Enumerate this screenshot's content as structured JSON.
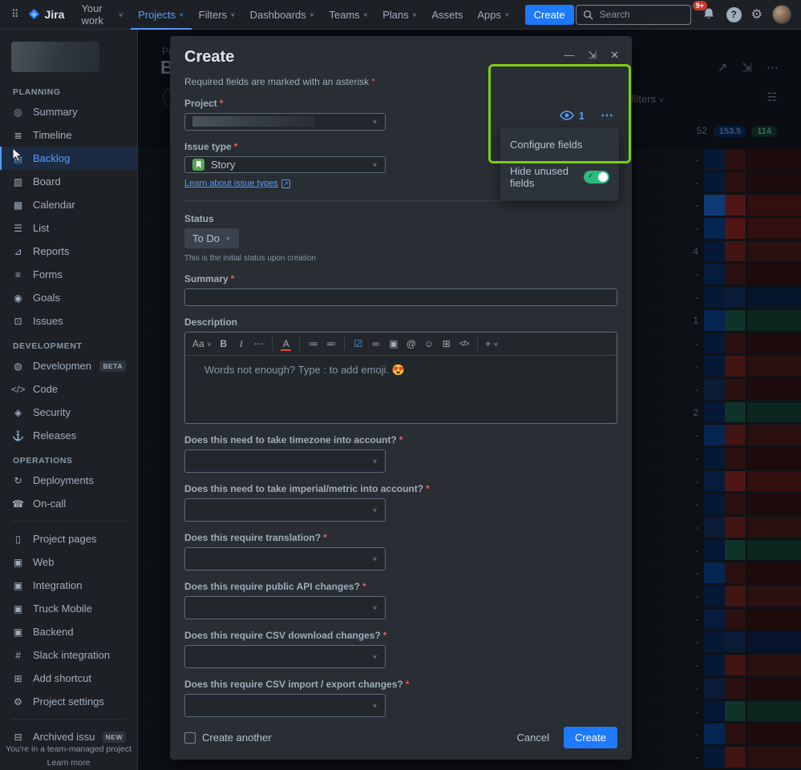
{
  "colors": {
    "accent_blue": "#579dff",
    "button_blue": "#1d7afc",
    "annotation_green": "#7ccd12",
    "toggle_green": "#2abb7f",
    "story_green": "#57a55a",
    "required_red": "#f15b50",
    "notification_red": "#c9372c"
  },
  "topnav": {
    "app_name": "Jira",
    "items": [
      {
        "label": "Your work"
      },
      {
        "label": "Projects",
        "active": true
      },
      {
        "label": "Filters"
      },
      {
        "label": "Dashboards"
      },
      {
        "label": "Teams"
      },
      {
        "label": "Plans"
      },
      {
        "label": "Assets",
        "chevron": false
      },
      {
        "label": "Apps"
      }
    ],
    "create_button": "Create",
    "search_placeholder": "Search",
    "notification_badge": "9+"
  },
  "sidebar": {
    "sections": [
      {
        "title": "PLANNING",
        "items": [
          {
            "label": "Summary",
            "icon": "summary-icon"
          },
          {
            "label": "Timeline",
            "icon": "timeline-icon"
          },
          {
            "label": "Backlog",
            "icon": "backlog-icon",
            "active": true
          },
          {
            "label": "Board",
            "icon": "board-icon"
          },
          {
            "label": "Calendar",
            "icon": "calendar-icon"
          },
          {
            "label": "List",
            "icon": "list-icon"
          },
          {
            "label": "Reports",
            "icon": "reports-icon"
          },
          {
            "label": "Forms",
            "icon": "forms-icon"
          },
          {
            "label": "Goals",
            "icon": "goals-icon"
          },
          {
            "label": "Issues",
            "icon": "issues-icon"
          }
        ]
      },
      {
        "title": "DEVELOPMENT",
        "items": [
          {
            "label": "Development",
            "icon": "development-icon",
            "badge": "BETA"
          },
          {
            "label": "Code",
            "icon": "code-icon"
          },
          {
            "label": "Security",
            "icon": "security-icon"
          },
          {
            "label": "Releases",
            "icon": "releases-icon"
          }
        ]
      },
      {
        "title": "OPERATIONS",
        "items": [
          {
            "label": "Deployments",
            "icon": "deployments-icon"
          },
          {
            "label": "On-call",
            "icon": "on-call-icon"
          }
        ]
      },
      {
        "title": "",
        "divider": true,
        "items": [
          {
            "label": "Project pages",
            "icon": "project-pages-icon"
          },
          {
            "label": "Web",
            "icon": "web-icon"
          },
          {
            "label": "Integration",
            "icon": "integration-icon"
          },
          {
            "label": "Truck Mobile",
            "icon": "truck-mobile-icon"
          },
          {
            "label": "Backend",
            "icon": "backend-icon"
          },
          {
            "label": "Slack integration",
            "icon": "slack-integration-icon"
          },
          {
            "label": "Add shortcut",
            "icon": "add-shortcut-icon"
          },
          {
            "label": "Project settings",
            "icon": "project-settings-icon"
          }
        ]
      },
      {
        "title": "",
        "divider": true,
        "items": [
          {
            "label": "Archived issues",
            "icon": "archived-issues-icon",
            "badge": "NEW"
          }
        ]
      }
    ],
    "footer_note": "You're in a team-managed project",
    "footer_link": "Learn more"
  },
  "background": {
    "breadcrumb": "Projects /",
    "page_title": "Backlog",
    "filters_label": "Version filters",
    "badges": [
      "52",
      "153.5",
      "114"
    ],
    "rows": [
      {
        "v": "-",
        "c1": "#09326c",
        "c2": "#5d1f1a",
        "c3": "#42140f"
      },
      {
        "v": "-",
        "c1": "#09326c",
        "c2": "#5d1f1a",
        "c3": "#42140f"
      },
      {
        "v": "-",
        "c1": "#1d7afc",
        "c2": "#ae2e24",
        "c3": "#6b1e16"
      },
      {
        "v": "-",
        "c1": "#0b4faa",
        "c2": "#ae2e24",
        "c3": "#6b1e16"
      },
      {
        "v": "4",
        "c1": "#09326c",
        "c2": "#8f2a1e",
        "c3": "#5d1f1a"
      },
      {
        "v": "-",
        "c1": "#0d3a7d",
        "c2": "#5d1f1a",
        "c3": "#42140f"
      },
      {
        "v": "-",
        "c1": "#09326c",
        "c2": "#143a6e",
        "c3": "#0d2b54"
      },
      {
        "v": "1",
        "c1": "#0b4faa",
        "c2": "#216e4e",
        "c3": "#17503a"
      },
      {
        "v": "-",
        "c1": "#09326c",
        "c2": "#5d1f1a",
        "c3": "#42140f"
      },
      {
        "v": "-",
        "c1": "#09326c",
        "c2": "#8f2a1e",
        "c3": "#5d1f1a"
      },
      {
        "v": "-",
        "c1": "#143a6e",
        "c2": "#5d1f1a",
        "c3": "#42140f"
      },
      {
        "v": "2",
        "c1": "#09326c",
        "c2": "#216e4e",
        "c3": "#17503a"
      },
      {
        "v": "-",
        "c1": "#0b4faa",
        "c2": "#8f2a1e",
        "c3": "#5d1f1a"
      },
      {
        "v": "-",
        "c1": "#09326c",
        "c2": "#5d1f1a",
        "c3": "#42140f"
      },
      {
        "v": "-",
        "c1": "#0d3a7d",
        "c2": "#ae2e24",
        "c3": "#6b1e16"
      },
      {
        "v": "-",
        "c1": "#09326c",
        "c2": "#5d1f1a",
        "c3": "#42140f"
      },
      {
        "v": "-",
        "c1": "#143a6e",
        "c2": "#8f2a1e",
        "c3": "#5d1f1a"
      },
      {
        "v": "-",
        "c1": "#09326c",
        "c2": "#216e4e",
        "c3": "#17503a"
      },
      {
        "v": "-",
        "c1": "#0b4faa",
        "c2": "#5d1f1a",
        "c3": "#42140f"
      },
      {
        "v": "-",
        "c1": "#09326c",
        "c2": "#8f2a1e",
        "c3": "#5d1f1a"
      },
      {
        "v": "-",
        "c1": "#0d3a7d",
        "c2": "#5d1f1a",
        "c3": "#42140f"
      },
      {
        "v": "-",
        "c1": "#09326c",
        "c2": "#143a6e",
        "c3": "#0d2b54"
      },
      {
        "v": "-",
        "c1": "#09326c",
        "c2": "#8f2a1e",
        "c3": "#5d1f1a"
      },
      {
        "v": "-",
        "c1": "#143a6e",
        "c2": "#5d1f1a",
        "c3": "#42140f"
      },
      {
        "v": "-",
        "c1": "#09326c",
        "c2": "#216e4e",
        "c3": "#17503a"
      },
      {
        "v": "-",
        "c1": "#0b4faa",
        "c2": "#5d1f1a",
        "c3": "#42140f"
      },
      {
        "v": "-",
        "c1": "#09326c",
        "c2": "#8f2a1e",
        "c3": "#5d1f1a"
      }
    ]
  },
  "modal": {
    "title": "Create",
    "required_note": "Required fields are marked with an asterisk",
    "asterisk": "*",
    "fields_menu": {
      "view_count": "1",
      "items": [
        "Configure fields",
        "Hide unused fields"
      ]
    },
    "project": {
      "label": "Project"
    },
    "issue_type": {
      "label": "Issue type",
      "value": "Story",
      "learn_link": "Learn about issue types"
    },
    "status": {
      "label": "Status",
      "value": "To Do",
      "help": "This is the initial status upon creation"
    },
    "summary": {
      "label": "Summary"
    },
    "description": {
      "label": "Description",
      "placeholder": "Words not enough? Type : to add emoji. 😍",
      "toolbar": [
        "text-style-icon",
        "bold-icon",
        "italic-icon",
        "more-formatting-icon",
        "divider",
        "text-color-icon",
        "divider",
        "bullet-list-icon",
        "numbered-list-icon",
        "divider",
        "task-checkbox-icon",
        "link-icon",
        "image-icon",
        "mention-icon",
        "emoji-icon",
        "table-icon",
        "code-icon",
        "divider",
        "insert-icon"
      ]
    },
    "questions": [
      {
        "label": "Does this need to take timezone into account?"
      },
      {
        "label": "Does this need to take imperial/metric into account?"
      },
      {
        "label": "Does this require translation?"
      },
      {
        "label": "Does this require public API changes?"
      },
      {
        "label": "Does this require CSV download changes?"
      },
      {
        "label": "Does this require CSV import / export changes?"
      }
    ],
    "footer": {
      "create_another": "Create another",
      "cancel": "Cancel",
      "create": "Create"
    }
  }
}
